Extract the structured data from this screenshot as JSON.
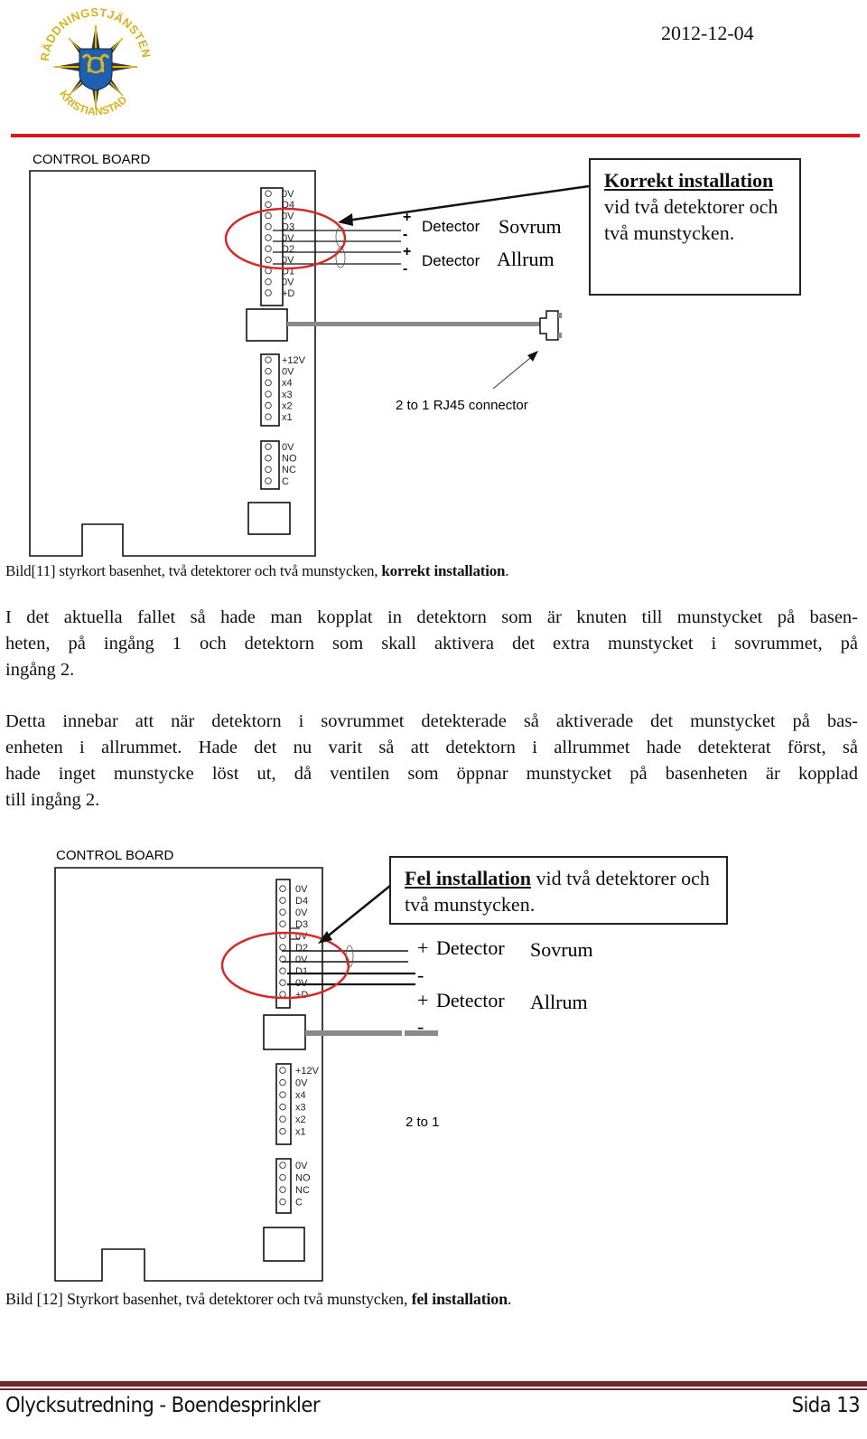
{
  "header": {
    "date": "2012-12-04",
    "logo": {
      "text_top": "RÄDDNINGSTJÄNSTEN",
      "text_bottom": "KRISTIANSTAD",
      "colors": {
        "gold": "#d9b21f",
        "blue": "#1d5fb0",
        "dark": "#3a3a2a"
      }
    },
    "rule_color": "#d7191c"
  },
  "figure1": {
    "board_title": "CONTROL BOARD",
    "terminal_block_1": [
      "0V",
      "D4",
      "0V",
      "D3",
      "0V",
      "D2",
      "0V",
      "D1",
      "0V",
      "+D"
    ],
    "terminal_block_2": [
      "+12V",
      "0V",
      "x4",
      "x3",
      "x2",
      "x1"
    ],
    "terminal_block_3": [
      "0V",
      "NO",
      "NC",
      "C"
    ],
    "wire_polarities": [
      "+",
      "-",
      "+",
      "-"
    ],
    "detectors": [
      {
        "label": "Detector",
        "room": "Sovrum"
      },
      {
        "label": "Detector",
        "room": "Allrum"
      }
    ],
    "connector_label": "2 to 1 RJ45 connector",
    "callout": {
      "bold": "Korrekt installation",
      "rest": " vid två detektorer och två munstycken."
    },
    "caption": {
      "text": "Bild[11] styrkort basenhet, två detektorer och två munstycken, ",
      "bold": "korrekt installation",
      "end": "."
    }
  },
  "body": {
    "paragraph1": "I det aktuella fallet så hade man kopplat in detektorn som är knuten till munstycket på basenheten, på ingång 1 och detektorn som skall aktivera det extra munstycket i sovrummet, på ingång 2.",
    "paragraph1_lines": [
      "I det aktuella fallet så hade man kopplat in detektorn som är knuten till munstycket på basen-",
      "heten, på ingång 1 och detektorn som skall aktivera det extra munstycket i sovrummet, på",
      "ingång 2."
    ],
    "paragraph2_lines": [
      "Detta innebar att när detektorn i sovrummet detekterade så aktiverade det munstycket på bas-",
      "enheten i allrummet. Hade det nu varit så att detektorn i allrummet hade detekterat först, så",
      "hade inget munstycke löst ut, då ventilen som öppnar munstycket på basenheten är kopplad",
      "till ingång 2."
    ]
  },
  "figure2": {
    "board_title": "CONTROL BOARD",
    "terminal_block_1": [
      "0V",
      "D4",
      "0V",
      "D3",
      "0V",
      "D2",
      "0V",
      "D1",
      "0V",
      "+D"
    ],
    "terminal_block_2": [
      "+12V",
      "0V",
      "x4",
      "x3",
      "x2",
      "x1"
    ],
    "terminal_block_3": [
      "0V",
      "NO",
      "NC",
      "C"
    ],
    "detectors": [
      {
        "plus": "+",
        "label": "Detector",
        "room": "Sovrum",
        "minus": "-"
      },
      {
        "plus": "+",
        "label": "Detector",
        "room": "Allrum",
        "minus": "-"
      }
    ],
    "connector_label_partial": "2 to 1",
    "callout": {
      "bold": "Fel installation",
      "rest": " vid två detektorer och två munstycken."
    },
    "caption": {
      "text": "Bild [12] Styrkort basenhet, två detektorer och två munstycken, ",
      "bold": "fel installation",
      "end": "."
    }
  },
  "footer": {
    "title": "Olycksutredning - Boendesprinkler",
    "page": "Sida 13",
    "rule_color": "#6b2a2e"
  },
  "colors": {
    "highlight_ellipse": "#d42a2a",
    "cable": "#8a8a8a"
  }
}
